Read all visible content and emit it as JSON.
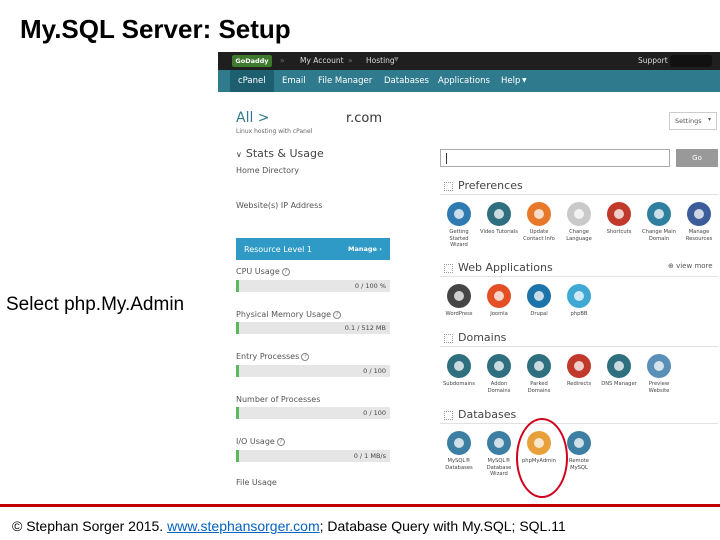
{
  "slide": {
    "title": "My.SQL Server: Setup",
    "caption": "Select php.My.Admin",
    "footer_pre": "© Stephan Sorger 2015. ",
    "footer_link": "www.stephansorger.com",
    "footer_post": "; Database Query with My.SQL;  SQL.11"
  },
  "topbar": {
    "logo": "GoDaddy",
    "crumbs": [
      "My Account",
      "Hosting"
    ],
    "support": "Support"
  },
  "nav": [
    "cPanel",
    "Email",
    "File Manager",
    "Databases",
    "Applications",
    "Help"
  ],
  "header": {
    "breadcrumb": "All >",
    "domain": "r.com",
    "subtitle": "Linux hosting with cPanel",
    "settings": "Settings"
  },
  "stats": {
    "heading": "Stats & Usage",
    "home_dir": "Home Directory",
    "ip": "Website(s) IP Address",
    "resource_level": "Resource Level 1",
    "manage": "Manage",
    "items": [
      {
        "label": "CPU Usage",
        "value": "0 / 100 %",
        "fraction": 0.02
      },
      {
        "label": "Physical Memory Usage",
        "value": "0.1 / 512 MB",
        "fraction": 0.02
      },
      {
        "label": "Entry Processes",
        "value": "0 / 100",
        "fraction": 0.02
      },
      {
        "label": "Number of Processes",
        "value": "0 / 100",
        "fraction": 0.02
      },
      {
        "label": "I/O Usage",
        "value": "0 / 1 MB/s",
        "fraction": 0.02
      }
    ],
    "file_usage": "File Usage"
  },
  "search": {
    "go": "Go"
  },
  "sections": {
    "preferences": "Preferences",
    "web_apps": "Web Applications",
    "view_more": "view more",
    "domains": "Domains",
    "databases": "Databases"
  },
  "preferences": [
    {
      "label": "Getting Started Wizard",
      "icon": "play-icon",
      "color": "#2f7ab0"
    },
    {
      "label": "Video Tutorials",
      "icon": "video-icon",
      "color": "#2f6f7f"
    },
    {
      "label": "Update Contact Info",
      "icon": "contact-icon",
      "color": "#e8792a"
    },
    {
      "label": "Change Language",
      "icon": "language-icon",
      "color": "#c9c9c9"
    },
    {
      "label": "Shortcuts",
      "icon": "star-icon",
      "color": "#c0392b"
    },
    {
      "label": "Change Main Domain",
      "icon": "domain-icon",
      "color": "#2f7f9f"
    },
    {
      "label": "Manage Resources",
      "icon": "resources-icon",
      "color": "#3d5d9a"
    }
  ],
  "apps": [
    {
      "label": "WordPress",
      "icon": "wordpress-icon",
      "color": "#464646"
    },
    {
      "label": "Joomla",
      "icon": "joomla-icon",
      "color": "#e44f26"
    },
    {
      "label": "Drupal",
      "icon": "drupal-icon",
      "color": "#1d74a9"
    },
    {
      "label": "phpBB",
      "icon": "phpbb-icon",
      "color": "#3fa9d4"
    }
  ],
  "domains": [
    {
      "label": "Subdomains",
      "icon": "subdomain-icon",
      "color": "#2f6f7f"
    },
    {
      "label": "Addon Domains",
      "icon": "addon-domain-icon",
      "color": "#2f6f7f"
    },
    {
      "label": "Parked Domains",
      "icon": "parked-domain-icon",
      "color": "#2f6f7f"
    },
    {
      "label": "Redirects",
      "icon": "redirect-icon",
      "color": "#c0392b"
    },
    {
      "label": "DNS Manager",
      "icon": "dns-icon",
      "color": "#2f6f7f"
    },
    {
      "label": "Preview Website",
      "icon": "preview-icon",
      "color": "#5a8fb7"
    }
  ],
  "databases": [
    {
      "label": "MySQL® Databases",
      "icon": "mysql-icon",
      "color": "#3d7fa3"
    },
    {
      "label": "MySQL® Database Wizard",
      "icon": "mysql-wizard-icon",
      "color": "#3d7fa3"
    },
    {
      "label": "phpMyAdmin",
      "icon": "phpmyadmin-icon",
      "color": "#e8a13a"
    },
    {
      "label": "Remote MySQL",
      "icon": "remote-mysql-icon",
      "color": "#3d7fa3"
    }
  ],
  "colors": {
    "nav": "#2f7a8c",
    "resource": "#2f9ac5",
    "highlight": "#d0021b",
    "footer_rule": "#c00000"
  }
}
